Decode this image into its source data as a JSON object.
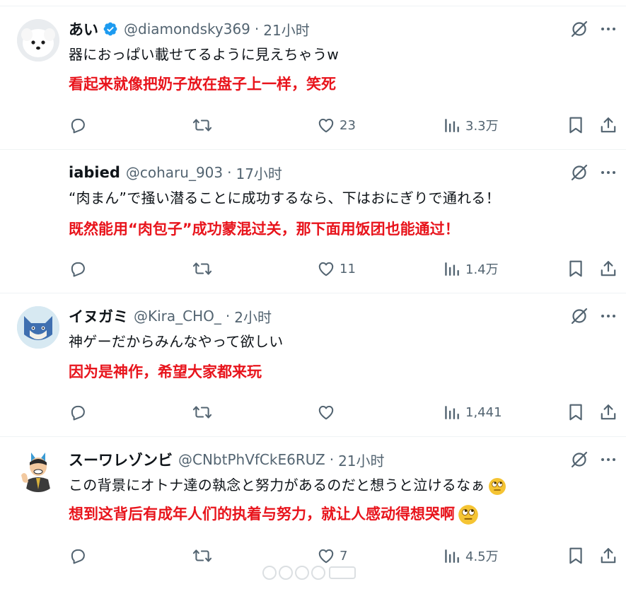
{
  "tweets": [
    {
      "name": "あい",
      "verified": true,
      "handle": "@diamondsky369",
      "separator": "·",
      "time": "21小时",
      "text": "器におっぱい載せてるように見えちゃうw",
      "translation": "看起来就像把奶子放在盘子上一样，笑死",
      "likes": "23",
      "views": "3.3万",
      "avatar": "white-dog-avatar"
    },
    {
      "name": "iabied",
      "verified": false,
      "handle": "@coharu_903",
      "separator": "·",
      "time": "17小时",
      "text": "“肉まん”で掻い潜ることに成功するなら、下はおにぎりで通れる！",
      "translation": "既然能用“肉包子”成功蒙混过关，那下面用饭团也能通过！",
      "likes": "11",
      "views": "1.4万",
      "avatar": "blank-avatar"
    },
    {
      "name": "イヌガミ",
      "verified": false,
      "handle": "@Kira_CHO_",
      "separator": "·",
      "time": "2小时",
      "text": "神ゲーだからみんなやって欲しい",
      "translation": "因为是神作，希望大家都来玩",
      "likes": "",
      "views": "1,441",
      "avatar": "blue-wolf-avatar"
    },
    {
      "name": "スーワレゾンビ",
      "verified": false,
      "handle": "@CNbtPhVfCkE6RUZ",
      "separator": "·",
      "time": "21小时",
      "text": "この背景にオトナ達の執念と努力があるのだと想うと泣けるなぁ",
      "translation": "想到这背后有成年人们的执着与努力，就让人感动得想哭啊",
      "likes": "7",
      "views": "4.5万",
      "avatar": "cartoon-man-avatar",
      "emoji": "face-with-rolling-eyes"
    }
  ],
  "icons": {
    "reply": "reply-icon",
    "retweet": "retweet-icon",
    "like": "heart-icon",
    "views": "views-icon",
    "bookmark": "bookmark-icon",
    "share": "share-icon",
    "grok": "grok-icon",
    "more": "more-icon"
  },
  "colors": {
    "text": "#0f1419",
    "secondary": "#536471",
    "translation": "#e8141c",
    "verified": "#1d9bf0",
    "divider": "#eff3f4"
  }
}
